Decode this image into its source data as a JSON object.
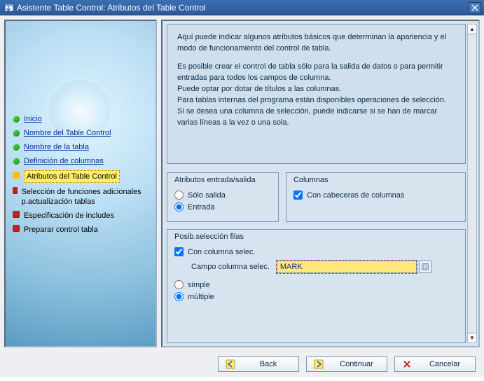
{
  "window": {
    "title": "Asistente Table Control: Atributos del Table Control"
  },
  "nav": {
    "items": [
      {
        "label": "Inicio",
        "state": "done",
        "link": true
      },
      {
        "label": "Nombre del Table Control",
        "state": "done",
        "link": true
      },
      {
        "label": "Nombre de la tabla",
        "state": "done",
        "link": true
      },
      {
        "label": "Definición de columnas",
        "state": "done",
        "link": true
      },
      {
        "label": "Atributos del Table Control",
        "state": "current",
        "link": false
      },
      {
        "label": "Selección de funciones adicionales p.actualización tablas",
        "state": "todo",
        "link": false
      },
      {
        "label": "Especificación de includes",
        "state": "todo",
        "link": false
      },
      {
        "label": "Preparar control tabla",
        "state": "todo",
        "link": false
      }
    ]
  },
  "help": {
    "p1": "Aquí puede indicar algunos atributos básicos que determinan la apariencia y el modo de funcionamiento del control de tabla.",
    "p2": "Es posible crear el control de tabla sólo para la salida de datos o para permitir entradas para todos los campos de columna.",
    "p3": "Puede optar por dotar de títulos a las columnas.",
    "p4": "Para tablas internas del programa están disponibles operaciones de selección.",
    "p5": "Si se desea una columna de selección, puede indicarse si se han de marcar varias líneas a la vez o una sola."
  },
  "groups": {
    "io": {
      "title": "Atributos entrada/salida",
      "opt_output": "Sólo salida",
      "opt_input": "Entrada",
      "selected": "input"
    },
    "cols": {
      "title": "Columnas",
      "chk_headers": "Con cabeceras de columnas",
      "headers_checked": true
    },
    "rowsel": {
      "title": "Posib.selección filas",
      "chk_selcol": "Con columna selec.",
      "selcol_checked": true,
      "field_label": "Campo columna selec.",
      "field_value": "MARK",
      "opt_single": "simple",
      "opt_multi": "múltiple",
      "mode": "multi"
    }
  },
  "footer": {
    "back": "Back",
    "continue": "Continuar",
    "cancel": "Cancelar"
  }
}
